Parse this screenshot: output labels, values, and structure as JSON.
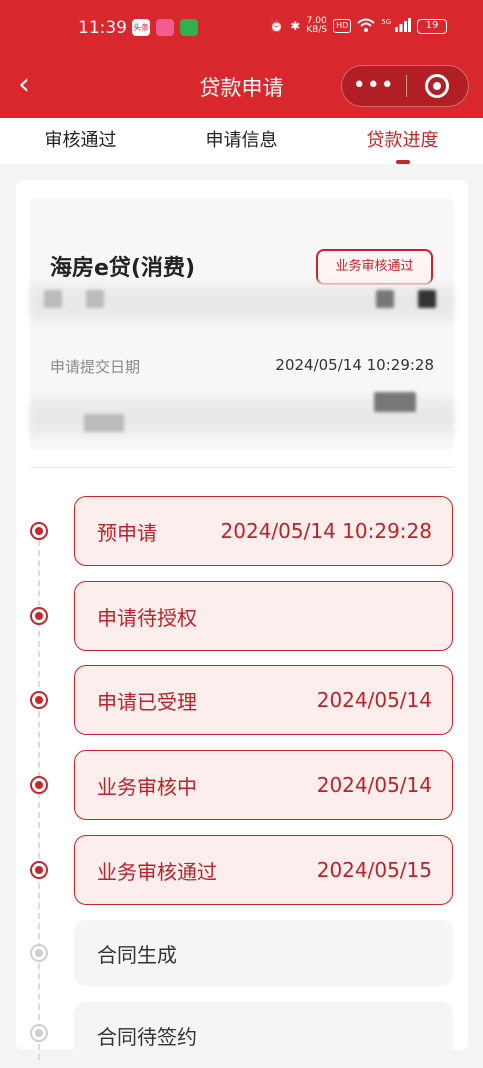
{
  "status_bar": {
    "time": "11:39",
    "apps": [
      "头条",
      "",
      ""
    ],
    "speed_top": "7.00",
    "speed_bottom": "KB/S",
    "hd": "HD",
    "network": "5G",
    "battery": "19"
  },
  "nav": {
    "back_icon": "‹",
    "title": "贷款申请",
    "more_icon": "•••"
  },
  "tabs": [
    {
      "label": "审核通过",
      "active": false
    },
    {
      "label": "申请信息",
      "active": false
    },
    {
      "label": "贷款进度",
      "active": true
    }
  ],
  "loan": {
    "name": "海房e贷(消费)",
    "status_badge": "业务审核通过",
    "submit_date_label": "申请提交日期",
    "submit_date_value": "2024/05/14 10:29:28"
  },
  "timeline": [
    {
      "label": "预申请",
      "date": "2024/05/14 10:29:28",
      "state": "done"
    },
    {
      "label": "申请待授权",
      "date": "",
      "state": "done"
    },
    {
      "label": "申请已受理",
      "date": "2024/05/14",
      "state": "done"
    },
    {
      "label": "业务审核中",
      "date": "2024/05/14",
      "state": "done"
    },
    {
      "label": "业务审核通过",
      "date": "2024/05/15",
      "state": "done"
    },
    {
      "label": "合同生成",
      "date": "",
      "state": "pending"
    },
    {
      "label": "合同待签约",
      "date": "",
      "state": "pending"
    }
  ],
  "colors": {
    "brand_red": "#d8272d",
    "accent_red": "#c3262b",
    "step_bg": "#fdeeee"
  }
}
